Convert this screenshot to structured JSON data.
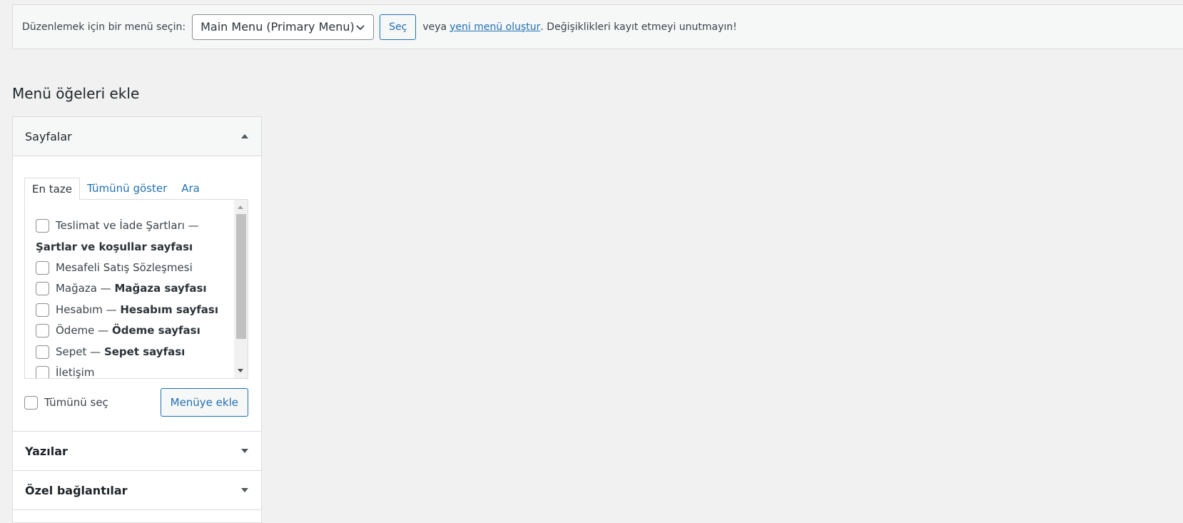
{
  "topbar": {
    "prompt": "Düzenlemek için bir menü seçin:",
    "selected_menu": "Main Menu (Primary Menu)",
    "select_button": "Seç",
    "or_text": "veya",
    "create_link": "yeni menü oluştur",
    "reminder": ". Değişiklikleri kayıt etmeyi unutmayın!"
  },
  "heading": "Menü öğeleri ekle",
  "pages_section": {
    "title": "Sayfalar",
    "tabs": [
      {
        "label": "En taze",
        "active": true
      },
      {
        "label": "Tümünü göster",
        "active": false
      },
      {
        "label": "Ara",
        "active": false
      }
    ],
    "items": [
      {
        "label": "Teslimat ve İade Şartları —",
        "note": "Şartlar ve koşullar sayfası"
      },
      {
        "label": "Mesafeli Satış Sözleşmesi",
        "note": ""
      },
      {
        "label": "Mağaza —",
        "note": "Mağaza sayfası"
      },
      {
        "label": "Hesabım —",
        "note": "Hesabım sayfası"
      },
      {
        "label": "Ödeme —",
        "note": "Ödeme sayfası"
      },
      {
        "label": "Sepet —",
        "note": "Sepet sayfası"
      },
      {
        "label": "İletişim",
        "note": ""
      }
    ],
    "select_all": "Tümünü seç",
    "add_button": "Menüye ekle"
  },
  "posts_section": {
    "title": "Yazılar"
  },
  "custom_links_section": {
    "title": "Özel bağlantılar"
  }
}
